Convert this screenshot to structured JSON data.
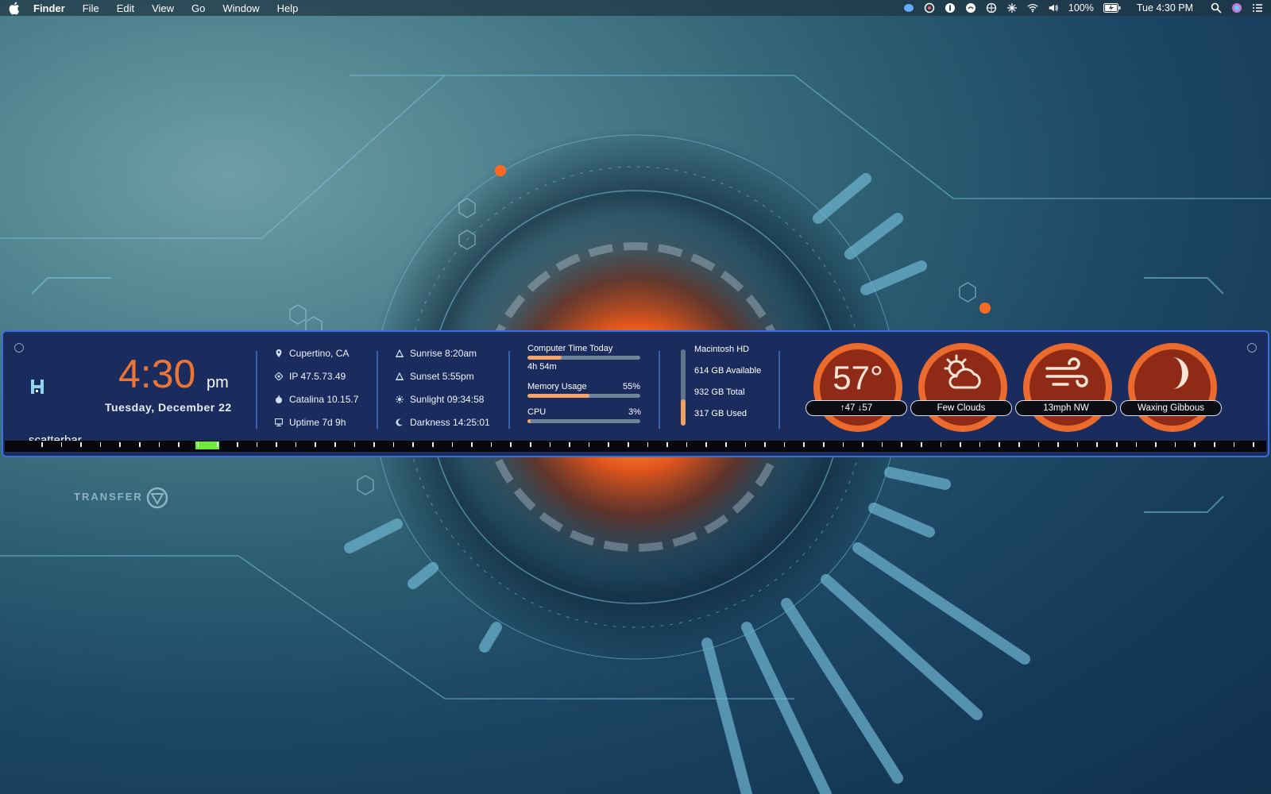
{
  "menubar": {
    "app": "Finder",
    "items": [
      "File",
      "Edit",
      "View",
      "Go",
      "Window",
      "Help"
    ],
    "battery": "100%",
    "clock": "Tue 4:30 PM"
  },
  "widget": {
    "brand": "scatterbar",
    "time": "4:30",
    "ampm": "pm",
    "date": "Tuesday, December 22",
    "system": {
      "location": "Cupertino, CA",
      "ip": "IP 47.5.73.49",
      "os": "Catalina 10.15.7",
      "uptime": "Uptime 7d 9h"
    },
    "sun": {
      "sunrise": "Sunrise 8:20am",
      "sunset": "Sunset 5:55pm",
      "sunlight": "Sunlight 09:34:58",
      "darkness": "Darkness 14:25:01"
    },
    "usage": {
      "computer_time_label": "Computer Time Today",
      "computer_time_value": "4h 54m",
      "computer_time_fraction": 0.3,
      "memory_label": "Memory Usage",
      "memory_value": "55%",
      "memory_fraction": 0.55,
      "cpu_label": "CPU",
      "cpu_value": "3%",
      "cpu_fraction": 0.03
    },
    "disk": {
      "name": "Macintosh HD",
      "available": "614 GB Available",
      "total": "932 GB Total",
      "used": "317 GB Used",
      "used_fraction": 0.34
    },
    "weather": {
      "temp": "57°",
      "hilo": "↑47  ↓57",
      "condition": "Few Clouds",
      "wind": "13mph NW",
      "moon": "Waxing Gibbous"
    }
  },
  "desktop": {
    "transfer_label": "TRANSFER"
  }
}
